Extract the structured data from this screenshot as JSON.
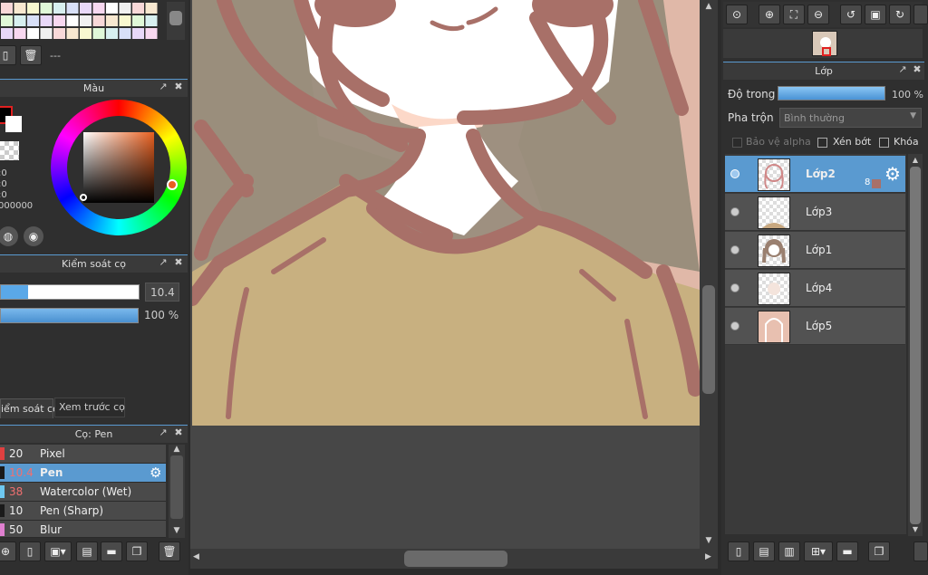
{
  "left": {
    "layer_tools": {
      "label": "---"
    },
    "color_panel": {
      "title": "Màu",
      "readouts": [
        ":0",
        ":0",
        ":0",
        "000000"
      ]
    },
    "brush_control": {
      "title": "Kiểm soát cọ",
      "size_value": "10.4",
      "size_fraction": 0.2,
      "opacity_value": "100 %",
      "opacity_fraction": 1.0
    },
    "tabs": [
      {
        "label": "iểm soát cọ"
      },
      {
        "label": "Xem trước cọ"
      }
    ],
    "brush_list": {
      "title": "Cọ: Pen",
      "items": [
        {
          "size": "20",
          "name": "Pixel",
          "color": "#e04040"
        },
        {
          "size": "10.4",
          "name": "Pen",
          "color": "#1a1a1a",
          "selected": true
        },
        {
          "size": "38",
          "name": "Watercolor (Wet)",
          "color": "#6ec8f0"
        },
        {
          "size": "10",
          "name": "Pen (Sharp)",
          "color": "#1a1a1a"
        },
        {
          "size": "50",
          "name": "Blur",
          "color": "#e080d0"
        }
      ]
    }
  },
  "layers_panel": {
    "title": "Lớp",
    "opacity_label": "Độ trong",
    "opacity_value": "100 %",
    "opacity_fraction": 1.0,
    "blend_label": "Pha trộn",
    "blend_value": "Bình thường",
    "protect_alpha": "Bảo vệ alpha",
    "clipping": "Xén bớt",
    "lock": "Khóa",
    "selected_badge": "8",
    "layers": [
      {
        "name": "Lớp2",
        "selected": true
      },
      {
        "name": "Lớp3"
      },
      {
        "name": "Lớp1"
      },
      {
        "name": "Lớp4"
      },
      {
        "name": "Lớp5"
      }
    ]
  },
  "colors": {
    "accent": "#5a9ad0",
    "hair": "#a87068",
    "shirt": "#c8b080",
    "skin": "#ffffff"
  }
}
